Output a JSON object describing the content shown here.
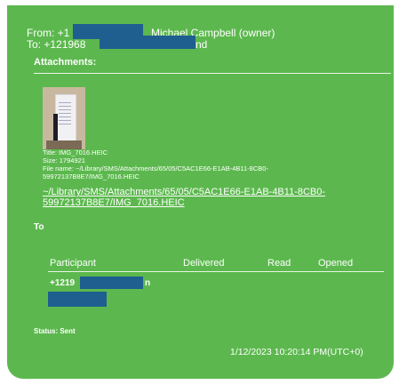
{
  "colors": {
    "panel": "#5cb84e",
    "redaction": "#1f5f8f",
    "text": "#ffffff"
  },
  "header": {
    "from_prefix": "From: +1",
    "from_suffix": "Michael Campbell (owner)",
    "to_prefix": "To: +121968",
    "to_suffix": "nd"
  },
  "attachments": {
    "label": "Attachments:",
    "thumbnail_icon": "photo-thumbnail",
    "title": "Title: IMG_7016.HEIC",
    "size": "Size: 1794921",
    "file_name_1": "File name: ~/Library/SMS/Attachments/65/05/C5AC1E66-E1AB-4B11-8CB0-",
    "file_name_2": "59972137B8E7/IMG_7016.HEIC",
    "link_1": "~/Library/SMS/Attachments/65/05/C5AC1E66-E1AB-4B11-8CB0-",
    "link_2": "59972137B8E7/IMG_7016.HEIC"
  },
  "to_section": {
    "label": "To",
    "columns": [
      "Participant",
      "Delivered",
      "Read",
      "Opened"
    ],
    "rows": [
      {
        "participant_prefix": "+1219",
        "participant_suffix": "n"
      }
    ]
  },
  "status": "Status: Sent",
  "timestamp": "1/12/2023 10:20:14 PM(UTC+0)"
}
